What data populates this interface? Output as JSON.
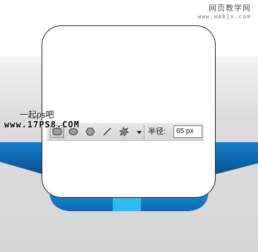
{
  "watermarks": {
    "top_cn": "网页教学网",
    "top_url": "www.webjx.com",
    "left_cn": "一起ps吧",
    "left_url": "www.17PS8.COM"
  },
  "toolbar": {
    "tools": [
      {
        "icon": "rounded-rectangle-icon",
        "active": true
      },
      {
        "icon": "ellipse-icon",
        "active": false
      },
      {
        "icon": "polygon-icon",
        "active": false
      },
      {
        "icon": "line-icon",
        "active": false
      },
      {
        "icon": "custom-shape-icon",
        "active": false
      }
    ],
    "dropdown_icon": "chevron-down-icon",
    "radius_label": "半径:",
    "radius_value": "65 px"
  },
  "colors": {
    "blue_dark": "#0b5fa6",
    "blue_mid": "#1b8fdc",
    "blue_light": "#2fb4f2",
    "card_border": "#222222",
    "card_fill": "#ffffff"
  }
}
